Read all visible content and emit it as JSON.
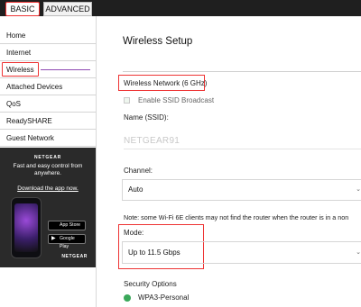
{
  "tabs": {
    "basic": "BASIC",
    "advanced": "ADVANCED"
  },
  "sidebar": {
    "items": [
      {
        "label": "Home"
      },
      {
        "label": "Internet"
      },
      {
        "label": "Wireless"
      },
      {
        "label": "Attached Devices"
      },
      {
        "label": "QoS"
      },
      {
        "label": "ReadySHARE"
      },
      {
        "label": "Guest Network"
      }
    ]
  },
  "promo": {
    "brand": "NETGEAR",
    "tagline": "Fast and easy control from anywhere.",
    "download_link": "Download the app now.",
    "app_store": "App Store",
    "google_play": "Google Play",
    "footer_brand": "NETGEAR",
    "app_store_glyph": "",
    "google_play_glyph": "▶"
  },
  "main": {
    "title": "Wireless Setup",
    "wireless_network": "Wireless Network (6 GHz)",
    "enable_ssid": "Enable SSID Broadcast",
    "name_label": "Name (SSID):",
    "ssid_value": "NETGEAR91",
    "channel_label": "Channel:",
    "channel_value": "Auto",
    "note": "Note: some Wi-Fi 6E clients may not find the router when the router is in a non",
    "mode_label": "Mode:",
    "mode_value": "Up to 11.5 Gbps",
    "security_label": "Security Options",
    "security_value": "WPA3-Personal",
    "chevron": "⌄"
  },
  "colors": {
    "highlight": "#ee3333",
    "accent_purple": "#8f4ab3",
    "radio_green": "#3aa85a"
  }
}
